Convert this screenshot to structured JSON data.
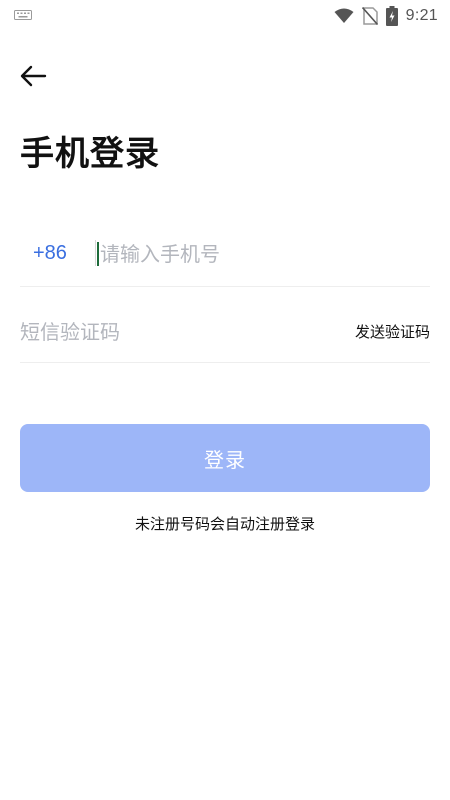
{
  "status_bar": {
    "time": "9:21",
    "icons": [
      "keyboard-icon",
      "wifi-icon",
      "no-sim-icon",
      "battery-charging-icon"
    ]
  },
  "header": {
    "back_icon": "arrow-left-icon",
    "title": "手机登录"
  },
  "form": {
    "country_code": "+86",
    "phone_placeholder": "请输入手机号",
    "phone_value": "",
    "code_placeholder": "短信验证码",
    "code_value": "",
    "send_code_label": "发送验证码"
  },
  "login_button": {
    "label": "登录",
    "state": "disabled"
  },
  "hint": "未注册号码会自动注册登录",
  "colors": {
    "accent": "#3a6fe0",
    "button_disabled": "#9db6f8",
    "text_primary": "#111111",
    "placeholder": "#b3b6bd",
    "divider": "#eeeeee"
  }
}
